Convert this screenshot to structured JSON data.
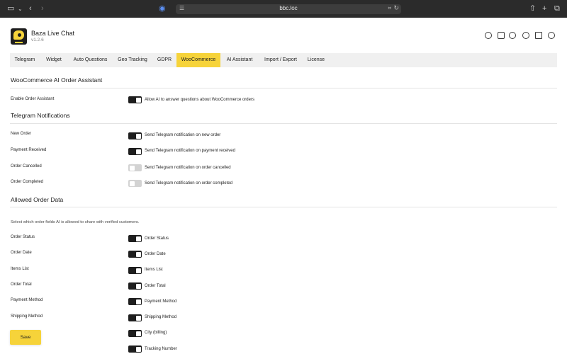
{
  "browser": {
    "url": "bbc.loc"
  },
  "app": {
    "title": "Baza Live Chat",
    "version": "v1.2.6"
  },
  "tabs": [
    {
      "label": "Telegram"
    },
    {
      "label": "Widget"
    },
    {
      "label": "Auto Questions"
    },
    {
      "label": "Geo Tracking"
    },
    {
      "label": "GDPR"
    },
    {
      "label": "WooCommerce",
      "active": true
    },
    {
      "label": "AI Assistant"
    },
    {
      "label": "Import / Export"
    },
    {
      "label": "License"
    }
  ],
  "assistant": {
    "title": "WooCommerce AI Order Assistant",
    "rows": [
      {
        "label": "Enable Order Assistant",
        "text": "Allow AI to answer questions about WooCommerce orders",
        "on": true
      }
    ]
  },
  "notifications": {
    "title": "Telegram Notifications",
    "rows": [
      {
        "label": "New Order",
        "text": "Send Telegram notification on new order",
        "on": true
      },
      {
        "label": "Payment Received",
        "text": "Send Telegram notification on payment received",
        "on": true
      },
      {
        "label": "Order Cancelled",
        "text": "Send Telegram notification on order cancelled",
        "on": false
      },
      {
        "label": "Order Completed",
        "text": "Send Telegram notification on order completed",
        "on": false
      }
    ]
  },
  "allowed": {
    "title": "Allowed Order Data",
    "description": "Select which order fields AI is allowed to share with verified customers.",
    "rows": [
      {
        "label": "Order Status",
        "text": "Order Status",
        "on": true
      },
      {
        "label": "Order Date",
        "text": "Order Date",
        "on": true
      },
      {
        "label": "Items List",
        "text": "Items List",
        "on": true
      },
      {
        "label": "Order Total",
        "text": "Order Total",
        "on": true
      },
      {
        "label": "Payment Method",
        "text": "Payment Method",
        "on": true
      },
      {
        "label": "Shipping Method",
        "text": "Shipping Method",
        "on": true
      },
      {
        "label": "",
        "text": "City (billing)",
        "on": true
      },
      {
        "label": "",
        "text": "Tracking Number",
        "on": true
      }
    ]
  },
  "save_label": "Save"
}
